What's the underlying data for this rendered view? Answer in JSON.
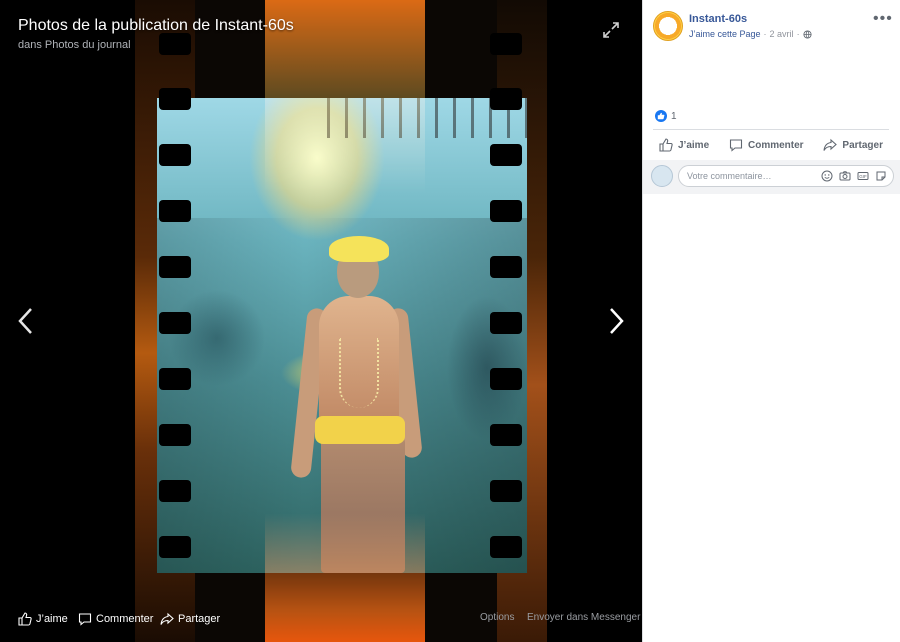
{
  "viewer": {
    "title": "Photos de la publication de Instant-60s",
    "subtitle": "dans Photos du journal",
    "actions": [
      {
        "label": "J’aime",
        "icon": "thumbs-up-icon"
      },
      {
        "label": "Commenter",
        "icon": "comment-icon"
      },
      {
        "label": "Partager",
        "icon": "share-icon"
      }
    ],
    "options_label": "Options",
    "messenger_label": "Envoyer dans Messenger"
  },
  "post": {
    "page_name": "Instant-60s",
    "like_page": "J’aime cette Page",
    "date": "2 avril",
    "separator": "·",
    "likes_count": "1",
    "actions": [
      {
        "label": "J’aime",
        "icon": "thumbs-up-icon"
      },
      {
        "label": "Commenter",
        "icon": "comment-icon"
      },
      {
        "label": "Partager",
        "icon": "share-icon"
      }
    ],
    "comment_placeholder": "Votre commentaire…"
  },
  "colors": {
    "link_blue": "#385898",
    "like_blue": "#1877f2",
    "viewer_bg": "#000000",
    "sidebar_bg": "#ffffff"
  }
}
